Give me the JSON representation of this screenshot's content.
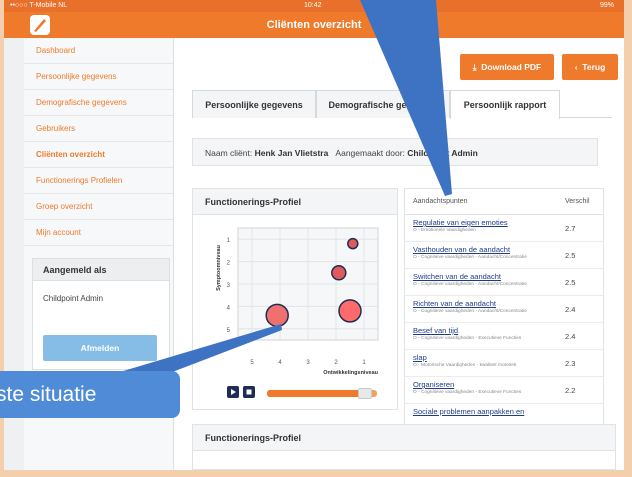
{
  "statusbar": {
    "carrier": "••○○○ T-Mobile NL",
    "time": "10:42",
    "battery": "99%"
  },
  "header": {
    "title": "Cliënten overzicht"
  },
  "sidebar": {
    "items": [
      {
        "label": "Dashboard"
      },
      {
        "label": "Persoonlijke gegevens"
      },
      {
        "label": "Demografische gegevens"
      },
      {
        "label": "Gebruikers"
      },
      {
        "label": "Cliënten overzicht"
      },
      {
        "label": "Functionerings Profielen"
      },
      {
        "label": "Groep overzicht"
      },
      {
        "label": "Mijn account"
      }
    ],
    "login": {
      "title": "Aangemeld als",
      "user": "Childpoint Admin",
      "logout": "Afmelden"
    }
  },
  "toolbar": {
    "download": "Download PDF",
    "back": "Terug"
  },
  "tabs": [
    {
      "label": "Persoonlijke gegevens"
    },
    {
      "label": "Demografische gegevens"
    },
    {
      "label": "Persoonlijk rapport"
    }
  ],
  "client": {
    "name_label": "Naam cliënt:",
    "name": "Henk Jan Vlietstra",
    "creator_label": "Aangemaakt door:",
    "creator": "Childpoint Admin"
  },
  "profile_panel": {
    "title": "Functionerings-Profiel"
  },
  "profile_panel_2": {
    "title": "Functionerings-Profiel"
  },
  "table": {
    "col_focus": "Aandachtspunten",
    "col_diff": "Verschil",
    "rows": [
      {
        "label": "Regulatie van eigen emoties",
        "sub": "O - Emotionele Vaardigheden",
        "value": "2.7"
      },
      {
        "label": "Vasthouden van de aandacht",
        "sub": "O - Cognitieve vaardigheden - Aandacht/Concentratie",
        "value": "2.5"
      },
      {
        "label": "Switchen van de aandacht",
        "sub": "O - Cognitieve vaardigheden - Aandacht/Concentratie",
        "value": "2.5"
      },
      {
        "label": "Richten van de aandacht",
        "sub": "O - Cognitieve vaardigheden - Aandacht/Concentratie",
        "value": "2.4"
      },
      {
        "label": "Besef van tijd",
        "sub": "O - Cognitieve vaardigheden - Executieve Functies",
        "value": "2.4"
      },
      {
        "label": "slap",
        "sub": "O - Motorische Vaardigheden - kwaliteit motoriek",
        "value": "2.3"
      },
      {
        "label": "Organiseren",
        "sub": "O - Cognitieve vaardigheden - Executieve Functies",
        "value": "2.2"
      },
      {
        "label": "Sociale problemen aanpakken en",
        "sub": "",
        "value": ""
      }
    ]
  },
  "callout": {
    "text": "ste situatie"
  },
  "chart_data": {
    "type": "scatter",
    "xlabel": "Ontwikkelingsniveau",
    "ylabel": "Symptoomniveau",
    "x_ticks": [
      "5",
      "4",
      "3",
      "2",
      "1"
    ],
    "y_ticks": [
      "1",
      "2",
      "3",
      "4",
      "5"
    ],
    "xlim": [
      5.5,
      0.5
    ],
    "ylim": [
      0.5,
      5.5
    ],
    "points": [
      {
        "x": 1.4,
        "y": 1.2,
        "size": 1,
        "color": "#e05a5a"
      },
      {
        "x": 1.9,
        "y": 2.5,
        "size": 1.4,
        "color": "#e05a5a"
      },
      {
        "x": 4.1,
        "y": 4.4,
        "size": 2.2,
        "color": "#f07070"
      },
      {
        "x": 1.5,
        "y": 4.2,
        "size": 2.2,
        "color": "#ff6b6b"
      }
    ],
    "grid": true,
    "slider_position": 0.9
  },
  "colors": {
    "accent": "#ef7a2b",
    "link": "#1f3c88",
    "callout": "#4f8bd6",
    "arrow": "#3e73c4"
  }
}
